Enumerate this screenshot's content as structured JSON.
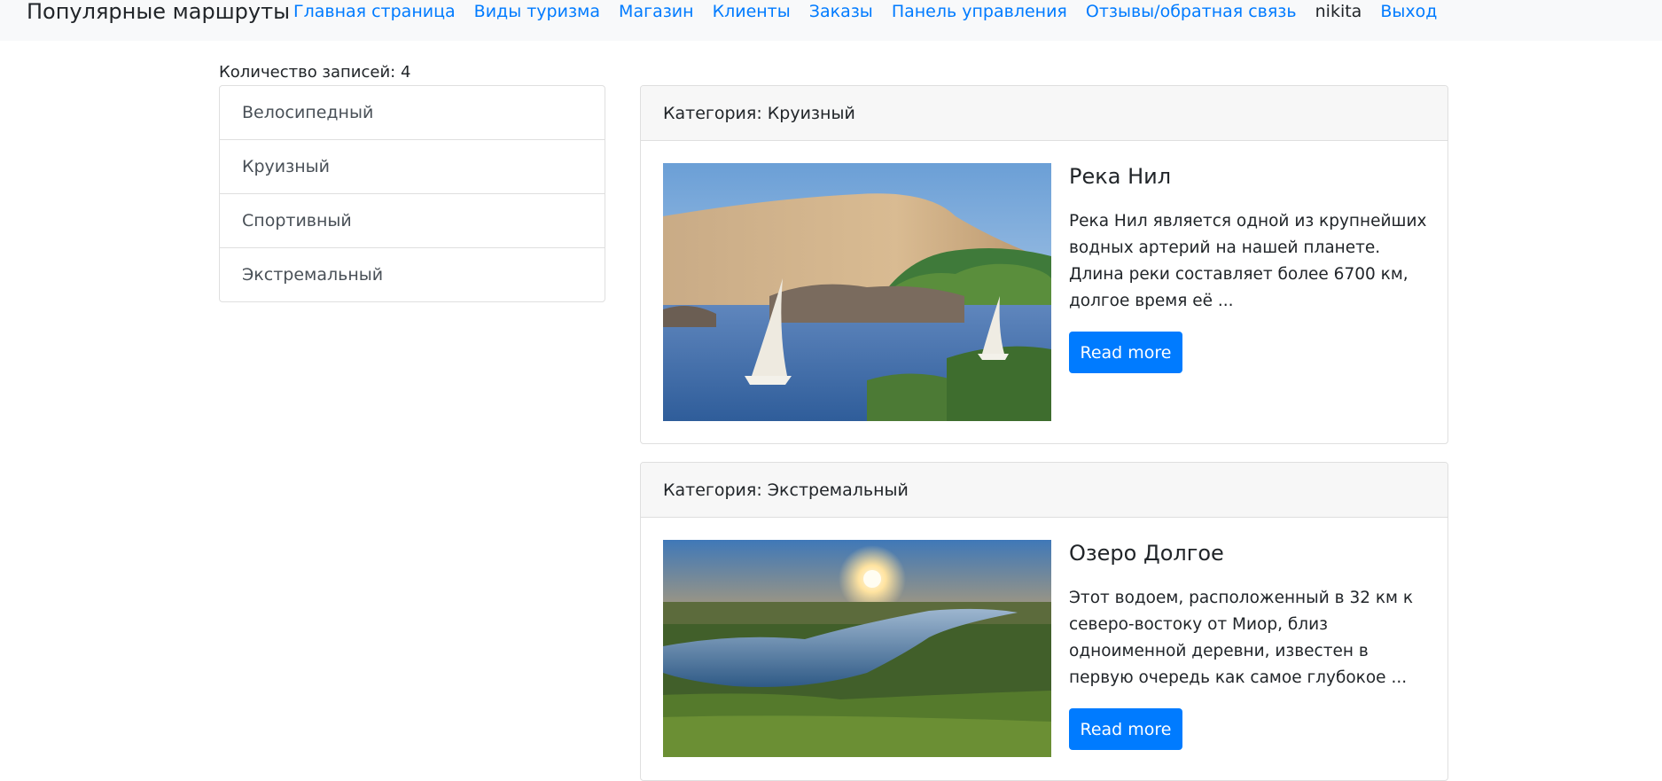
{
  "navbar": {
    "brand": "Популярные маршруты",
    "links": [
      "Главная страница",
      "Виды туризма",
      "Магазин",
      "Клиенты",
      "Заказы",
      "Панель управления",
      "Отзывы/обратная связь"
    ],
    "user": "nikita",
    "logout": "Выход"
  },
  "sidebar": {
    "count_text": "Количество записей: 4",
    "categories": [
      "Велосипедный",
      "Круизный",
      "Спортивный",
      "Экстремальный"
    ]
  },
  "cards": [
    {
      "header": "Категория: Круизный",
      "title": "Река Нил",
      "text": "Река Нил является одной из крупнейших водных артерий на нашей планете. Длина реки составляет более 6700 км, долгое время её ...",
      "button": "Read more"
    },
    {
      "header": "Категория: Экстремальный",
      "title": "Озеро Долгое",
      "text": "Этот водоем, расположенный в 32 км к северо-востоку от Миор, близ одноименной деревни, известен в первую очередь как самое глубокое ...",
      "button": "Read more"
    }
  ],
  "colors": {
    "link": "#007bff",
    "button": "#007bff",
    "navbar_bg": "#f8f9fa",
    "card_header_bg": "#f7f7f7"
  }
}
